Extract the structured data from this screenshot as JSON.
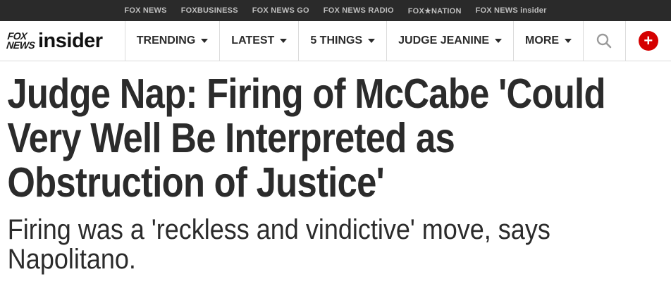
{
  "topbar": {
    "links": [
      "FOX NEWS",
      "FOXBUSINESS",
      "FOX NEWS GO",
      "FOX NEWS RADIO",
      "FOX★NATION",
      "FOX NEWS insider"
    ]
  },
  "logo": {
    "fox_line1": "FOX",
    "fox_line2": "NEWS",
    "insider": "insider"
  },
  "nav": {
    "items": [
      {
        "label": "TRENDING"
      },
      {
        "label": "LATEST"
      },
      {
        "label": "5 THINGS"
      },
      {
        "label": "JUDGE JEANINE"
      },
      {
        "label": "MORE"
      }
    ],
    "search_icon": "search-icon",
    "plus_icon": "plus-circle-icon",
    "plus_symbol": "+"
  },
  "article": {
    "headline": "Judge Nap: Firing of McCabe 'Could Very Well Be Interpreted as Obstruction of Justice'",
    "subheadline": "Firing was a 'reckless and vindictive' move, says Napolitano."
  },
  "colors": {
    "topbar_bg": "#2a2a2a",
    "accent_red": "#d50000",
    "text": "#2b2b2b"
  }
}
